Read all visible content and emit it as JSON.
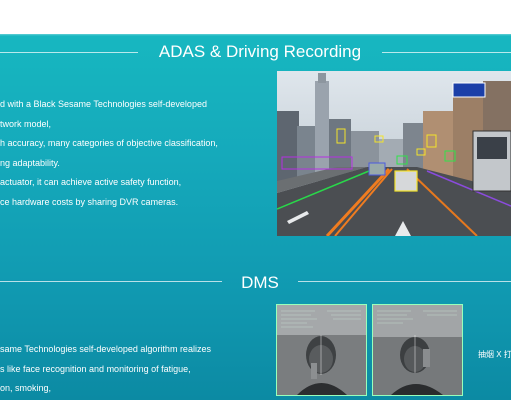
{
  "adas": {
    "title": "ADAS & Driving Recording",
    "bullets": [
      "d with a Black Sesame Technologies self-developed",
      "twork model,",
      "h accuracy, many categories of objective classification,",
      "ng adaptability.",
      "actuator, it can achieve active safety function,",
      "ce hardware costs by sharing DVR cameras."
    ]
  },
  "dms": {
    "title": "DMS",
    "bullets": [
      "same Technologies self-developed algorithm realizes",
      "s like face recognition and monitoring of fatigue,",
      "on, smoking,"
    ],
    "caption": "抽烟 X 打"
  }
}
